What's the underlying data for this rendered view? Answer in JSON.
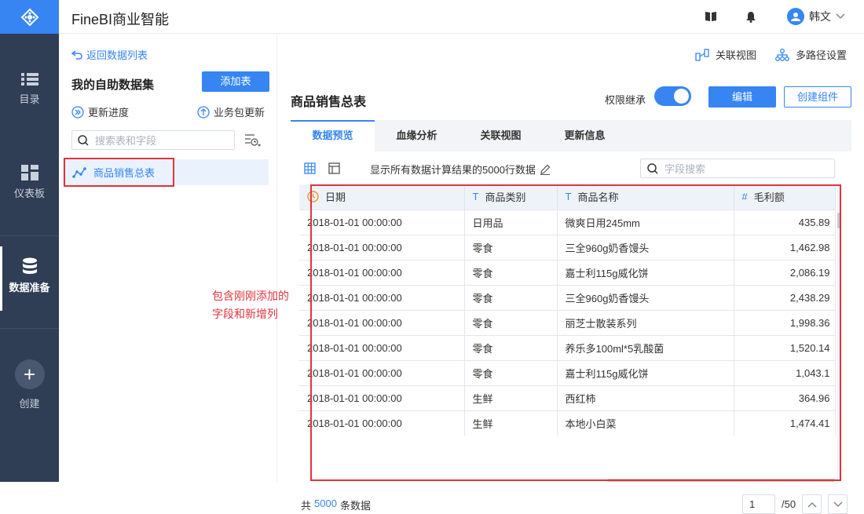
{
  "app": {
    "title": "FineBI商业智能"
  },
  "topbar": {
    "user_name": "韩文"
  },
  "nav": {
    "items": [
      {
        "label": "目录",
        "icon": "list-icon"
      },
      {
        "label": "仪表板",
        "icon": "dashboard-icon"
      },
      {
        "label": "数据准备",
        "icon": "database-icon"
      },
      {
        "label": "创建",
        "icon": "plus-icon"
      }
    ]
  },
  "left": {
    "back_label": "返回数据列表",
    "title": "我的自助数据集",
    "add_table_label": "添加表",
    "update_progress_label": "更新进度",
    "business_pkg_update_label": "业务包更新",
    "search_placeholder": "搜索表和字段",
    "tree_item_label": "商品销售总表"
  },
  "right": {
    "link_view_label": "关联视图",
    "multipath_label": "多路径设置",
    "table_title": "商品销售总表",
    "permission_label": "权限继承",
    "permission_on": true,
    "edit_label": "编辑",
    "create_component_label": "创建组件",
    "tabs": [
      {
        "label": "数据预览",
        "active": true
      },
      {
        "label": "血缘分析",
        "active": false
      },
      {
        "label": "关联视图",
        "active": false
      },
      {
        "label": "更新信息",
        "active": false
      }
    ],
    "show_text": "显示所有数据计算结果的5000行数据",
    "field_search_placeholder": "字段搜索",
    "columns": [
      {
        "type": "clock",
        "type_glyph": "",
        "label": "日期"
      },
      {
        "type": "text",
        "type_glyph": "T",
        "label": "商品类别"
      },
      {
        "type": "text",
        "type_glyph": "T",
        "label": "商品名称"
      },
      {
        "type": "number",
        "type_glyph": "#",
        "label": "毛利额"
      }
    ],
    "rows": [
      [
        "2018-01-01 00:00:00",
        "日用品",
        "微爽日用245mm",
        "435.89"
      ],
      [
        "2018-01-01 00:00:00",
        "零食",
        "三全960g奶香馒头",
        "1,462.98"
      ],
      [
        "2018-01-01 00:00:00",
        "零食",
        "嘉士利115g威化饼",
        "2,086.19"
      ],
      [
        "2018-01-01 00:00:00",
        "零食",
        "三全960g奶香馒头",
        "2,438.29"
      ],
      [
        "2018-01-01 00:00:00",
        "零食",
        "丽芝士散装系列",
        "1,998.36"
      ],
      [
        "2018-01-01 00:00:00",
        "零食",
        "养乐多100ml*5乳酸菌",
        "1,520.14"
      ],
      [
        "2018-01-01 00:00:00",
        "零食",
        "嘉士利115g威化饼",
        "1,043.1"
      ],
      [
        "2018-01-01 00:00:00",
        "生鲜",
        "西红柿",
        "364.96"
      ],
      [
        "2018-01-01 00:00:00",
        "生鲜",
        "本地小白菜",
        "1,474.41"
      ]
    ],
    "annotation_line1": "包含刚刚添加的",
    "annotation_line2": "字段和新增列",
    "footer": {
      "prefix": "共",
      "count": "5000",
      "suffix": "条数据"
    },
    "pager": {
      "current": "1",
      "total": "/50"
    }
  },
  "colors": {
    "accent": "#3685f2",
    "nav_bg": "#2f3d55",
    "highlight": "#e0333d"
  }
}
